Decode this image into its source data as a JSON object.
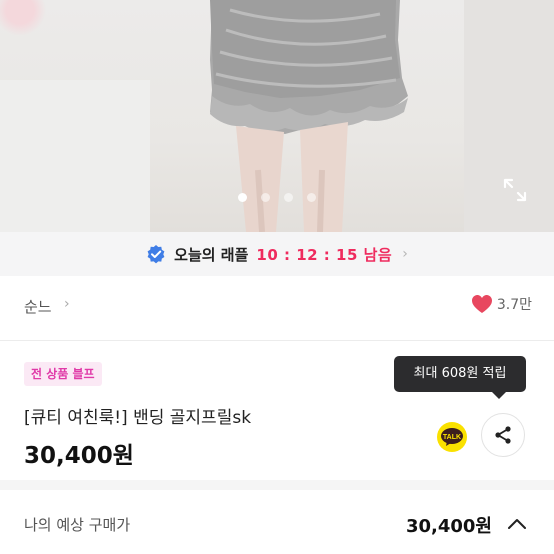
{
  "gallery": {
    "dot_count": 4,
    "active_dot": 0,
    "expand_icon": "expand-icon"
  },
  "raffle": {
    "label": "오늘의 래플",
    "timer": "10 : 12 : 15 남음",
    "badge_icon": "verified-badge-icon",
    "chevron": "›"
  },
  "shop": {
    "name": "순느",
    "chevron": "›",
    "likes": "3.7만",
    "heart_color": "#e8475f"
  },
  "product": {
    "tag": "전 상품 블프",
    "title": "[큐티 여친룩!] 밴딩 골지프릴sk",
    "price": "30,400원"
  },
  "tooltip": {
    "text": "최대 608원 적립"
  },
  "actions": {
    "kakao_label": "TALK",
    "share_icon": "share-icon"
  },
  "estimate": {
    "label": "나의 예상 구매가",
    "price": "30,400원"
  },
  "colors": {
    "accent": "#ef2b5e",
    "tag_text": "#e03aa8",
    "tag_bg": "#fbe9f5",
    "kakao_yellow": "#fae100"
  }
}
